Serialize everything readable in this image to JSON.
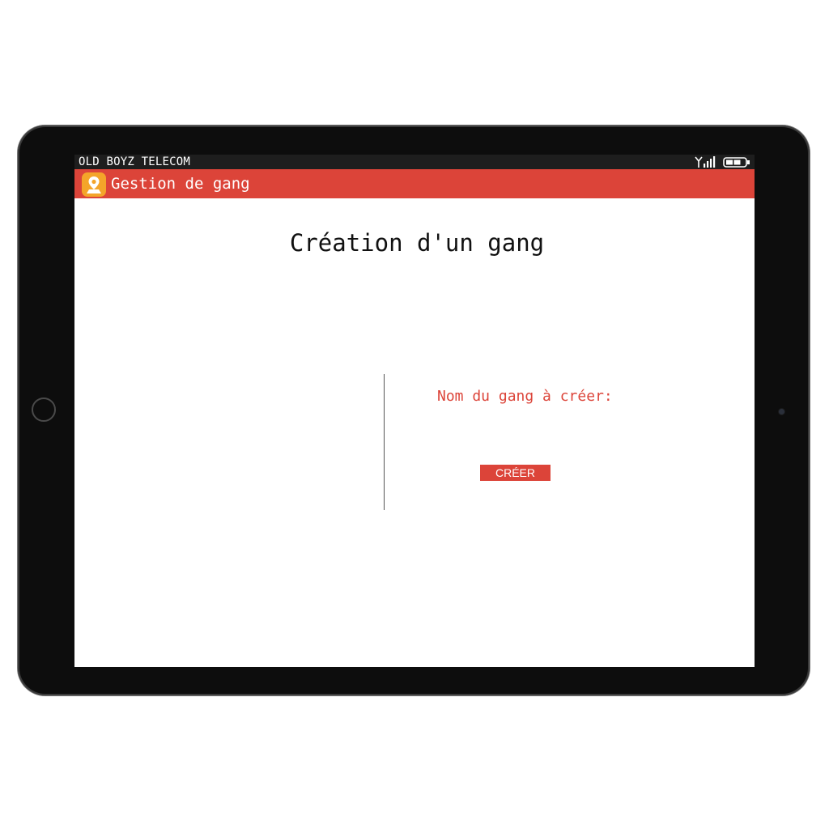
{
  "status_bar": {
    "carrier": "OLD BOYZ TELECOM",
    "signal_icon": "signal-strength-icon",
    "battery_icon": "battery-icon"
  },
  "app_bar": {
    "icon": "map-pin-app-icon",
    "title": "Gestion de gang"
  },
  "main": {
    "title": "Création d'un gang",
    "form": {
      "label": "Nom du gang à créer:",
      "submit_label": "CRÉER"
    }
  },
  "colors": {
    "accent": "#dc4439",
    "app_icon": "#f4a52a",
    "status_bar": "#1e1e1e",
    "device_frame": "#0d0d0d"
  }
}
